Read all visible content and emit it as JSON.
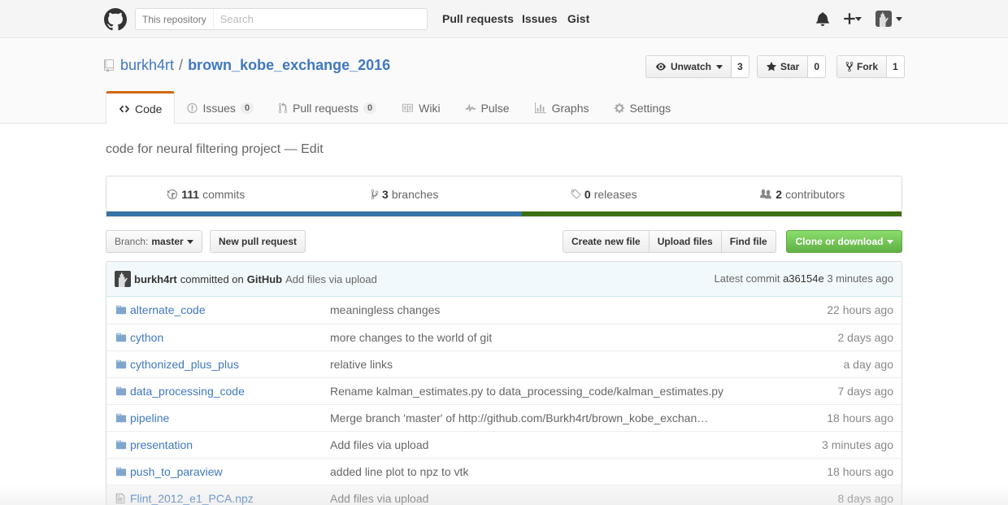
{
  "header": {
    "search_scope": "This repository",
    "search_placeholder": "Search",
    "nav": [
      "Pull requests",
      "Issues",
      "Gist"
    ]
  },
  "repo": {
    "owner": "burkh4rt",
    "separator": "/",
    "name": "brown_kobe_exchange_2016",
    "watch_label": "Unwatch",
    "watch_count": "3",
    "star_label": "Star",
    "star_count": "0",
    "fork_label": "Fork",
    "fork_count": "1"
  },
  "tabs": [
    {
      "label": "Code",
      "icon": "code-icon"
    },
    {
      "label": "Issues",
      "counter": "0",
      "icon": "issue-opened-icon"
    },
    {
      "label": "Pull requests",
      "counter": "0",
      "icon": "git-pull-request-icon"
    },
    {
      "label": "Wiki",
      "icon": "book-icon"
    },
    {
      "label": "Pulse",
      "icon": "pulse-icon"
    },
    {
      "label": "Graphs",
      "icon": "graph-icon"
    },
    {
      "label": "Settings",
      "icon": "gear-icon"
    }
  ],
  "description": {
    "text": "code for neural filtering project",
    "dash": " — ",
    "edit": "Edit"
  },
  "summary": {
    "commits_count": "111",
    "commits_label": "commits",
    "branches_count": "3",
    "branches_label": "branches",
    "releases_count": "0",
    "releases_label": "releases",
    "contributors_count": "2",
    "contributors_label": "contributors"
  },
  "langbar": [
    {
      "share": 52.2,
      "color": "#3572a5"
    },
    {
      "share": 47.8,
      "color": "#3e6e12"
    }
  ],
  "toolbar": {
    "branch_prefix": "Branch:",
    "branch_name": "master",
    "new_pr": "New pull request",
    "create_file": "Create new file",
    "upload_files": "Upload files",
    "find_file": "Find file",
    "clone": "Clone or download"
  },
  "commit": {
    "author": "burkh4rt",
    "committed_on": "committed on",
    "platform": "GitHub",
    "message": "Add files via upload",
    "latest_label": "Latest commit",
    "sha": "a36154e",
    "age": "3 minutes ago"
  },
  "files": [
    {
      "name": "alternate_code",
      "type": "dir",
      "message": "meaningless changes",
      "age": "22 hours ago"
    },
    {
      "name": "cython",
      "type": "dir",
      "message": "more changes to the world of git",
      "age": "2 days ago"
    },
    {
      "name": "cythonized_plus_plus",
      "type": "dir",
      "message": "relative links",
      "age": "a day ago"
    },
    {
      "name": "data_processing_code",
      "type": "dir",
      "message": "Rename kalman_estimates.py to data_processing_code/kalman_estimates.py",
      "age": "7 days ago"
    },
    {
      "name": "pipeline",
      "type": "dir",
      "message": "Merge branch 'master' of http://github.com/Burkh4rt/brown_kobe_exchan…",
      "age": "18 hours ago"
    },
    {
      "name": "presentation",
      "type": "dir",
      "message": "Add files via upload",
      "age": "3 minutes ago"
    },
    {
      "name": "push_to_paraview",
      "type": "dir",
      "message": "added line plot to npz to vtk",
      "age": "18 hours ago"
    },
    {
      "name": "Flint_2012_e1_PCA.npz",
      "type": "file",
      "message": "Add files via upload",
      "age": "8 days ago"
    }
  ]
}
